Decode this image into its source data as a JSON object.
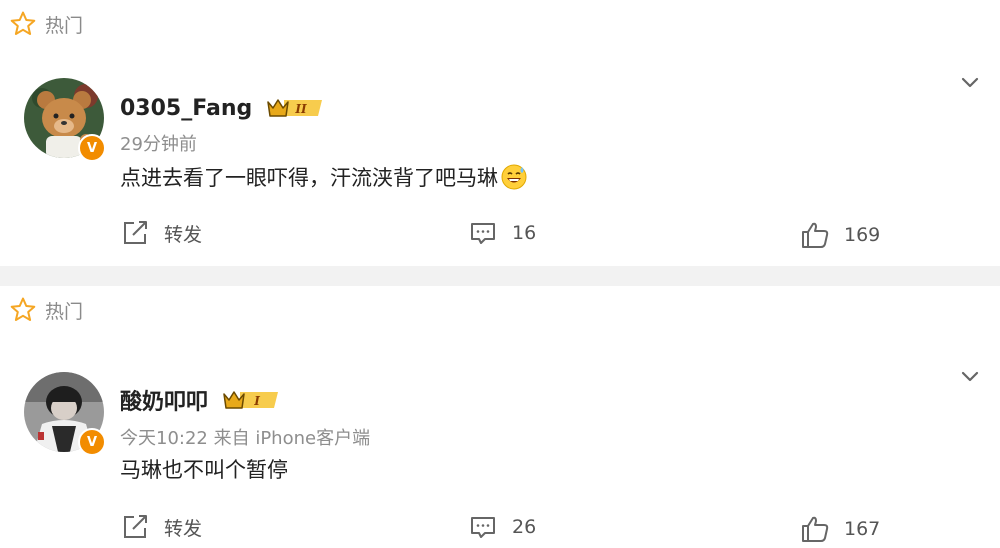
{
  "comments": [
    {
      "hot_label": "热门",
      "username": "0305_Fang",
      "level_badge": "II",
      "meta": "29分钟前",
      "content": "点进去看了一眼吓得，汗流浃背了吧马琳",
      "forward_label": "转发",
      "comment_count": "16",
      "like_count": "169",
      "verified_mark": "V"
    },
    {
      "hot_label": "热门",
      "username": "酸奶叩叩",
      "level_badge": "I",
      "meta": "今天10:22 来自 iPhone客户端",
      "content": "马琳也不叫个暂停",
      "forward_label": "转发",
      "comment_count": "26",
      "like_count": "167",
      "verified_mark": "V"
    }
  ],
  "colors": {
    "badge_orange": "#f28c00",
    "hot_star": "#f5a623",
    "crown_gold": "#f2c03a",
    "separator": "#f2f2f2"
  },
  "icons": [
    "star-outline-icon",
    "verified-v-icon",
    "vip-crown-icon",
    "chevron-down-icon",
    "forward-icon",
    "comment-icon",
    "like-icon",
    "sweat-smile-emoji"
  ]
}
